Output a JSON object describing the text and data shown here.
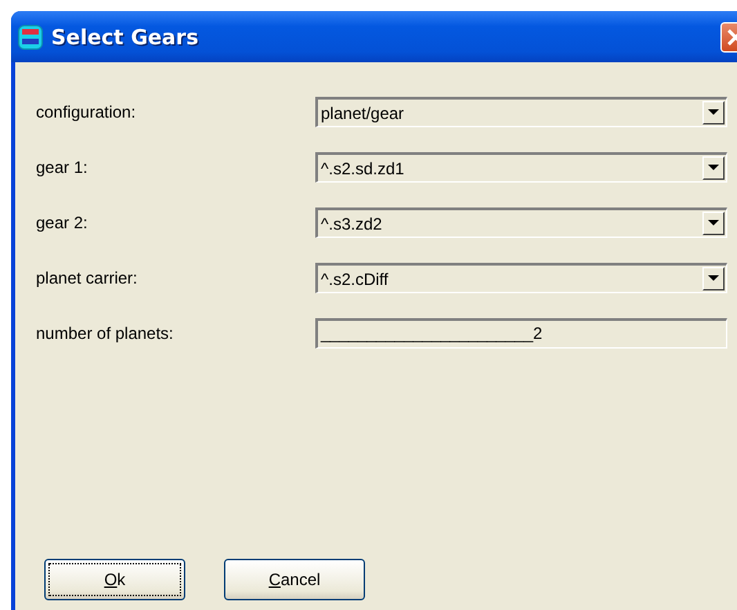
{
  "window": {
    "title": "Select Gears"
  },
  "fields": [
    {
      "kind": "combo",
      "label": "configuration:",
      "value": "planet/gear"
    },
    {
      "kind": "combo",
      "label": "gear 1:",
      "value": "^.s2.sd.zd1"
    },
    {
      "kind": "combo",
      "label": "gear 2:",
      "value": "^.s3.zd2"
    },
    {
      "kind": "combo",
      "label": "planet carrier:",
      "value": "^.s2.cDiff"
    },
    {
      "kind": "text",
      "label": "number of planets:",
      "value": "_______________________2",
      "disabled": true
    }
  ],
  "buttons": [
    {
      "label": "Ok",
      "focused": true
    },
    {
      "label": "Cancel",
      "focused": false
    }
  ]
}
